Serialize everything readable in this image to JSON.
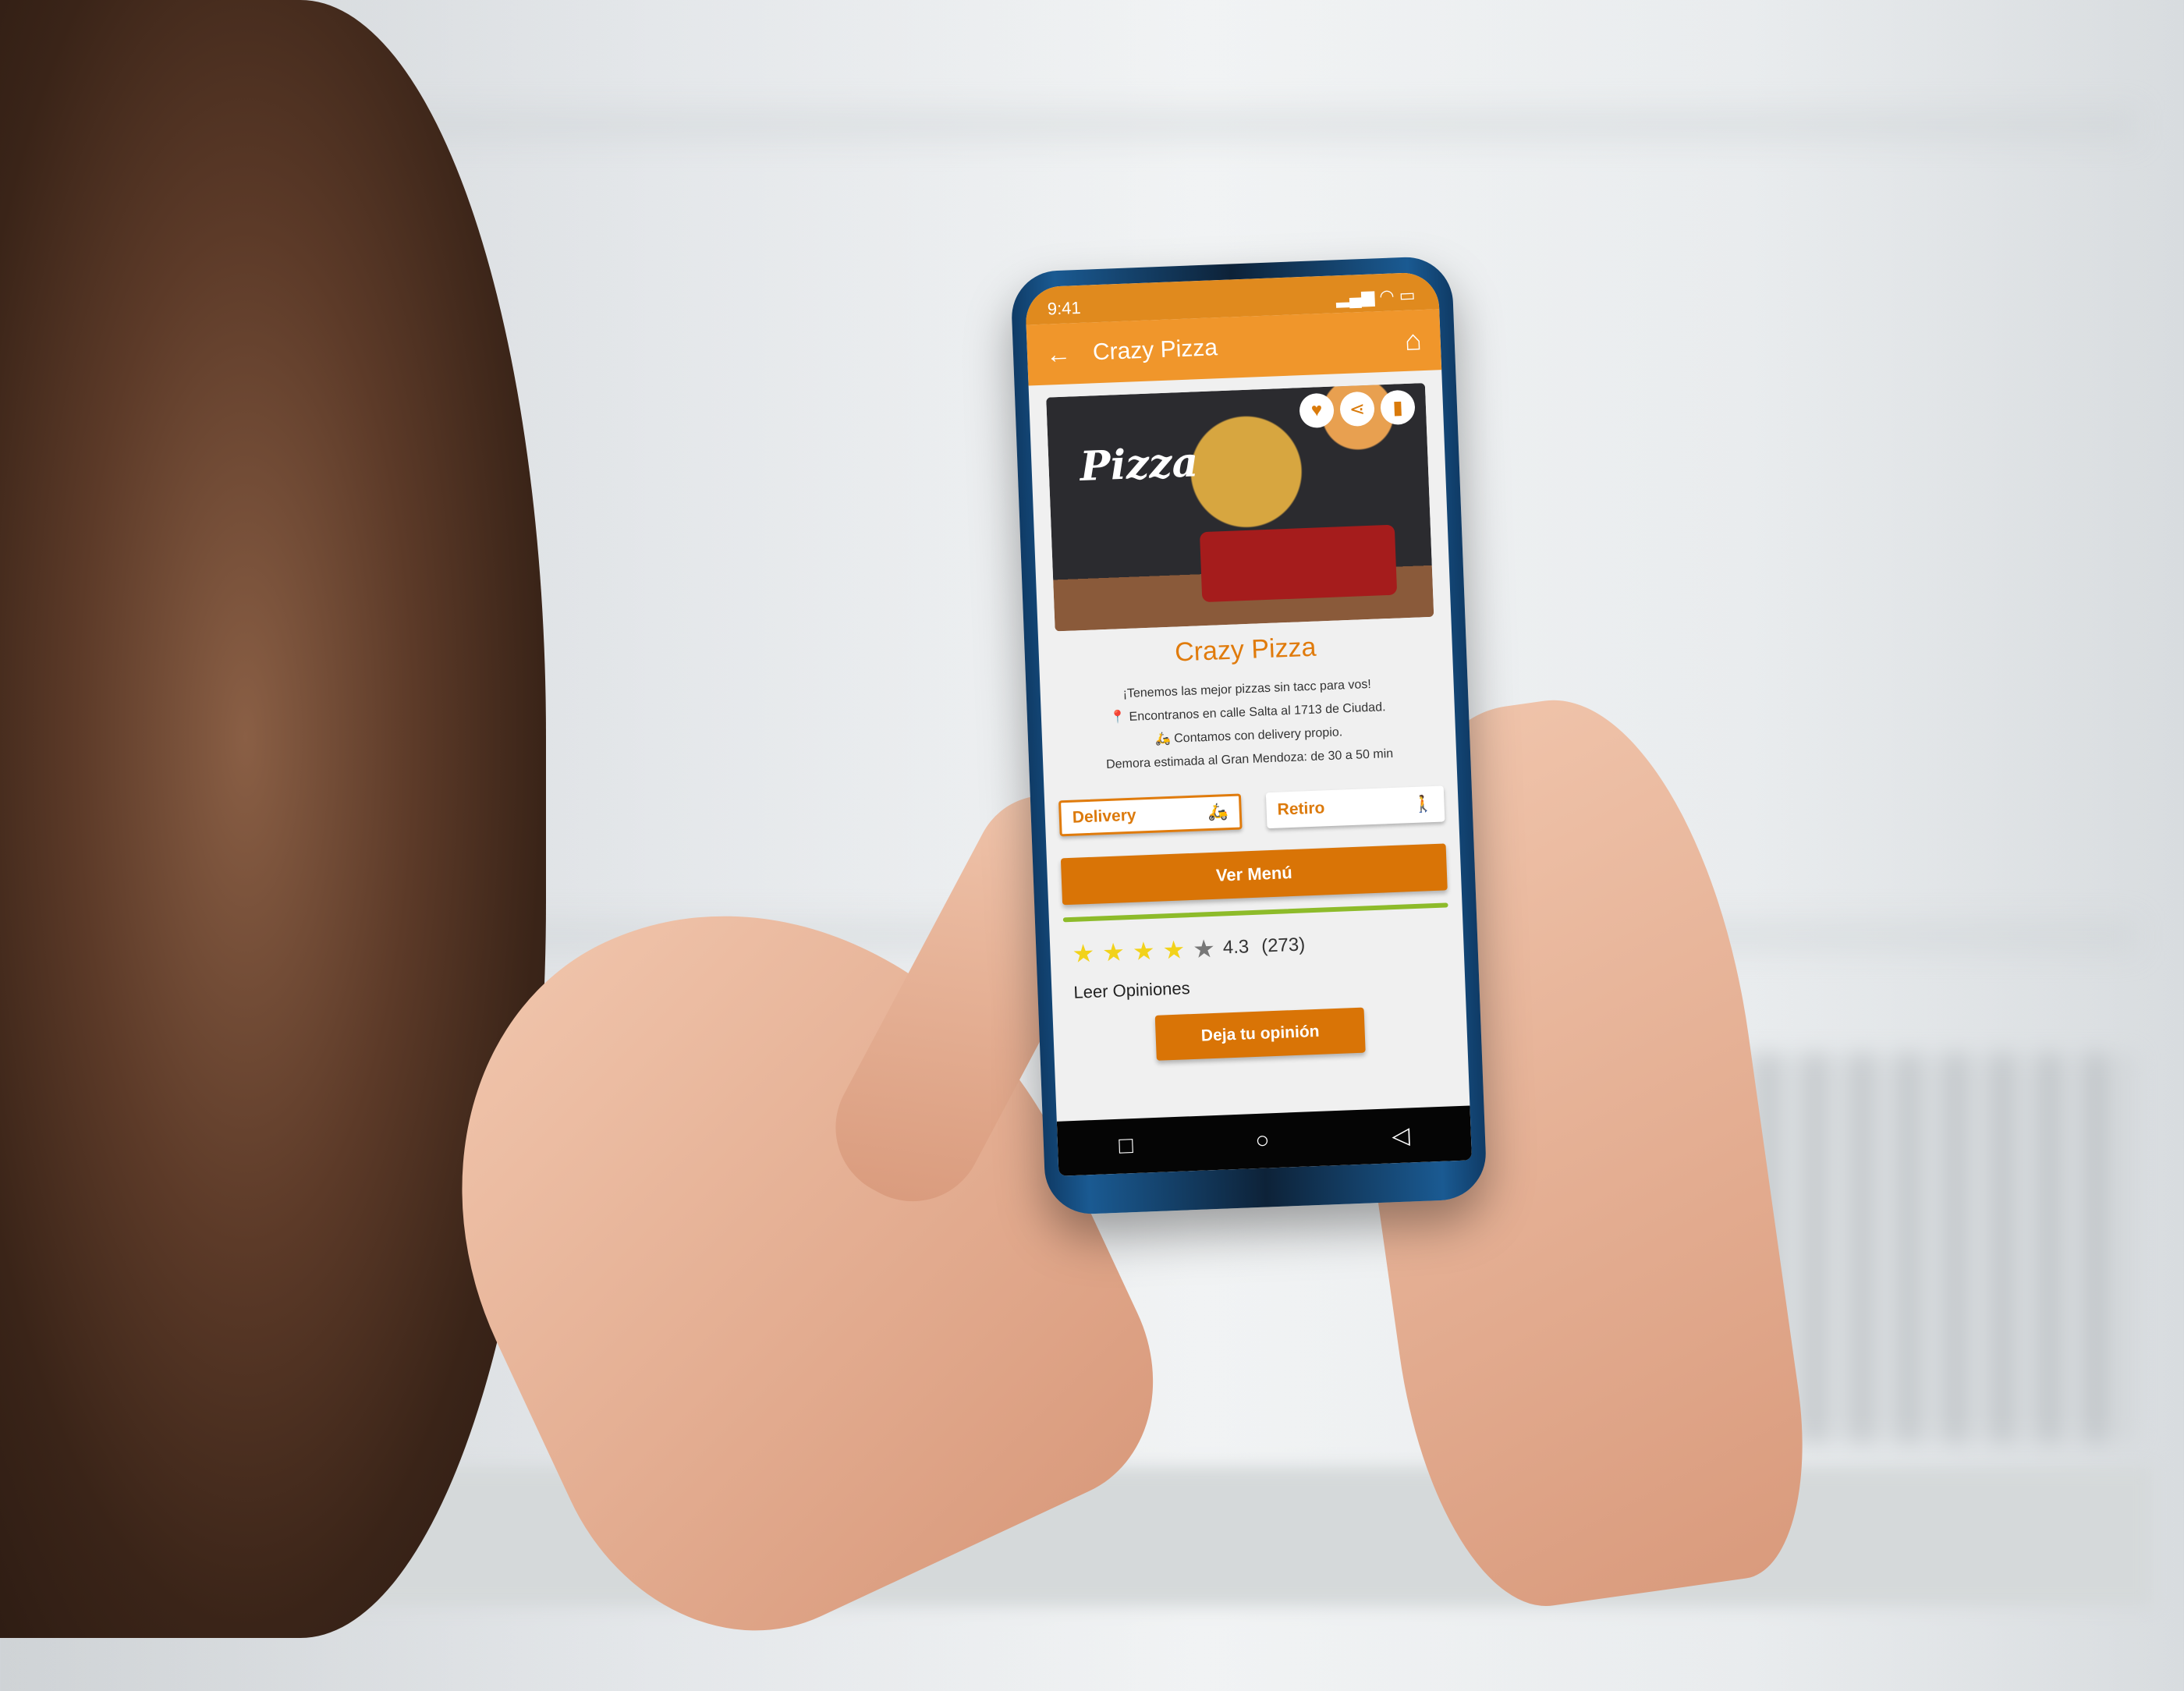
{
  "status_bar": {
    "time": "9:41"
  },
  "app_bar": {
    "title": "Crazy Pizza",
    "back_icon": "arrow-left",
    "home_icon": "home"
  },
  "hero": {
    "image_text": "Pizza",
    "actions": [
      "heart",
      "share",
      "bookmark"
    ]
  },
  "restaurant": {
    "name": "Crazy Pizza",
    "tagline": "¡Tenemos las mejor pizzas sin tacc para vos!",
    "address": "Encontranos en calle Salta al 1713 de Ciudad.",
    "delivery_note": "Contamos con delivery propio.",
    "eta": "Demora estimada al Gran Mendoza: de 30 a 50 min"
  },
  "options": {
    "delivery": "Delivery",
    "pickup": "Retiro",
    "selected": "Delivery"
  },
  "menu_button": "Ver Menú",
  "rating": {
    "score": "4.3",
    "count": "(273)",
    "stars_filled": 4,
    "stars_total": 5
  },
  "read_reviews": "Leer Opiniones",
  "review_button": "Deja tu opinión",
  "colors": {
    "primary": "#f0962b",
    "accent": "#d97406",
    "divider": "#8dbb2a",
    "star": "#f2d21a"
  }
}
